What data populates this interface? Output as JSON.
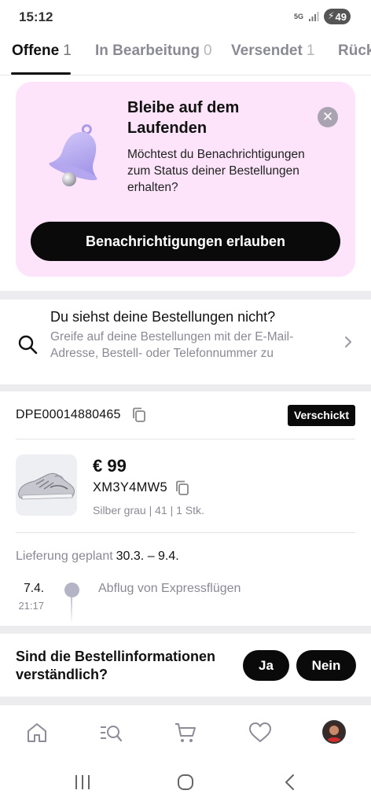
{
  "status_bar": {
    "time": "15:12",
    "network": "5G",
    "battery": "49"
  },
  "tabs": [
    {
      "label": "Offene",
      "count": "1"
    },
    {
      "label": "In Bearbeitung",
      "count": "0"
    },
    {
      "label": "Versendet",
      "count": "1"
    },
    {
      "label": "Rück",
      "count": ""
    }
  ],
  "notification_card": {
    "title": "Bleibe auf dem Laufenden",
    "text": "Möchtest du Benachrichtigungen zum Status deiner Bestellungen erhalten?",
    "button_label": "Benachrichtigungen erlauben",
    "close_symbol": "✕",
    "icon": "bell-icon"
  },
  "missing_orders": {
    "title": "Du siehst deine Bestellungen nicht?",
    "text": "Greife auf deine Bestellungen mit der E-Mail-Adresse, Bestell- oder Telefonnummer zu"
  },
  "order": {
    "number": "DPE00014880465",
    "status": "Verschickt",
    "price": "€ 99",
    "sku": "XM3Y4MW5",
    "variant": "Silber grau | 41 | 1 Stk.",
    "delivery_label": "Lieferung geplant",
    "delivery_dates": "30.3. – 9.4.",
    "tracking": {
      "date": "7.4.",
      "time": "21:17",
      "event": "Abflug von Expressflügen"
    }
  },
  "feedback": {
    "question": "Sind die Bestellinformationen verständlich?",
    "yes": "Ja",
    "no": "Nein"
  },
  "bottom_nav": [
    "home-icon",
    "search-list-icon",
    "cart-icon",
    "heart-icon",
    "avatar"
  ],
  "colors": {
    "accent_card": "#fde4fa",
    "primary": "#0a0a0a",
    "muted_text": "#8a8a95"
  }
}
